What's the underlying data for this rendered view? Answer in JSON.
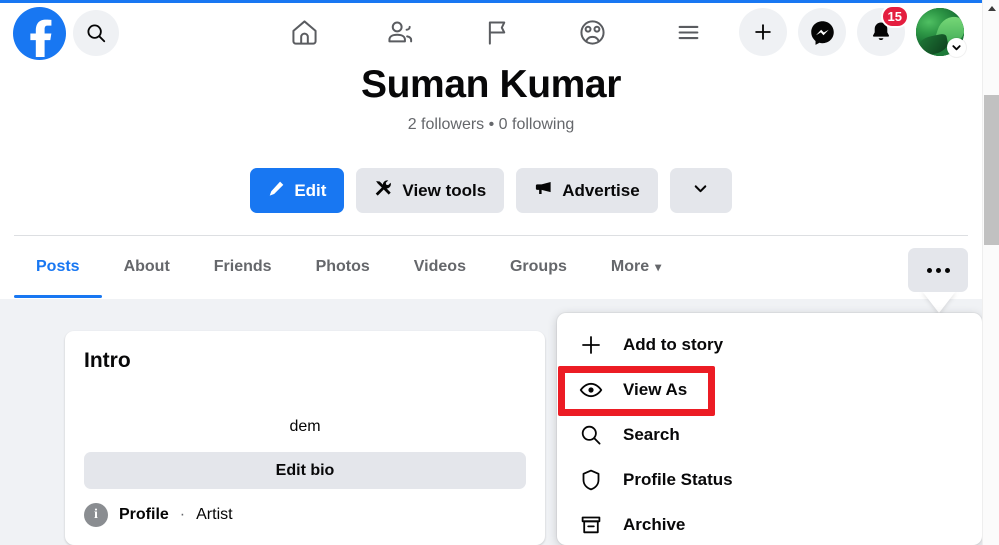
{
  "header": {
    "logo_icon": "facebook-logo-icon",
    "search_icon": "search-icon",
    "nav_icons": [
      {
        "name": "home-icon",
        "label": "Home"
      },
      {
        "name": "friends-icon",
        "label": "Friends"
      },
      {
        "name": "flag-icon",
        "label": "Pages"
      },
      {
        "name": "groups-icon",
        "label": "Groups"
      },
      {
        "name": "menu-icon",
        "label": "Menu"
      }
    ],
    "create_icon": "plus-icon",
    "messenger_icon": "messenger-icon",
    "notifications_icon": "bell-icon",
    "notifications_count": "15",
    "account_icon": "avatar-chevron-down-icon"
  },
  "profile": {
    "name": "Suman Kumar",
    "stats": "2 followers • 0 following",
    "actions": [
      {
        "label": "Edit",
        "icon": "pencil-icon",
        "style": "primary"
      },
      {
        "label": "View tools",
        "icon": "tools-icon",
        "style": "secondary"
      },
      {
        "label": "Advertise",
        "icon": "megaphone-icon",
        "style": "secondary"
      },
      {
        "label": "",
        "icon": "chevron-down-icon",
        "style": "icon-only"
      }
    ]
  },
  "tabs": [
    {
      "label": "Posts",
      "active": true
    },
    {
      "label": "About",
      "active": false
    },
    {
      "label": "Friends",
      "active": false
    },
    {
      "label": "Photos",
      "active": false
    },
    {
      "label": "Videos",
      "active": false
    },
    {
      "label": "Groups",
      "active": false
    },
    {
      "label": "More",
      "active": false,
      "caret": "▾"
    }
  ],
  "more_button": {
    "icon": "ellipsis-icon",
    "label": "More options"
  },
  "intro_card": {
    "title": "Intro",
    "bio_text": "dem",
    "edit_bio_label": "Edit bio",
    "detail_icon": "info-icon",
    "detail_primary": "Profile",
    "detail_separator": "·",
    "detail_secondary": "Artist"
  },
  "dropdown_menu": {
    "items": [
      {
        "label": "Add to story",
        "icon": "plus-icon"
      },
      {
        "label": "View As",
        "icon": "eye-icon",
        "highlighted": true
      },
      {
        "label": "Search",
        "icon": "search-icon"
      },
      {
        "label": "Profile Status",
        "icon": "shield-icon"
      },
      {
        "label": "Archive",
        "icon": "archive-icon"
      }
    ]
  },
  "annotation": {
    "highlight_color": "#ec1c24",
    "highlight_target": "View As"
  },
  "colors": {
    "brand_blue": "#1877f2",
    "page_bg": "#f0f2f5",
    "card_bg": "#ffffff",
    "button_grey": "#e4e6eb",
    "badge_red": "#e41e3f",
    "text_primary": "#080809",
    "text_secondary": "#65676b"
  },
  "scrollbar": {
    "up_arrow_icon": "scroll-up-arrow-icon",
    "thumb": "scroll-thumb"
  }
}
